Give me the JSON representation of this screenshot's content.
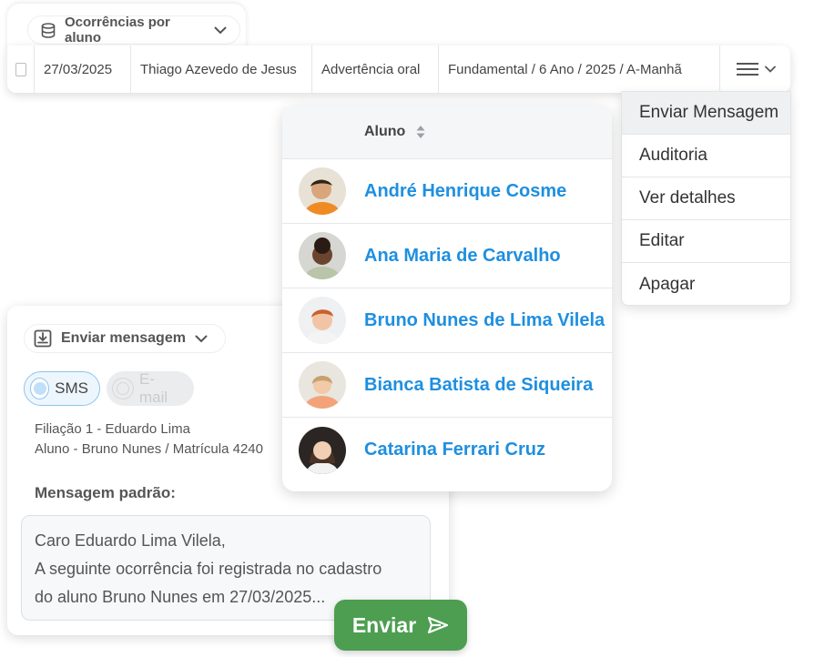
{
  "top_tab": {
    "label": "Ocorrências por aluno"
  },
  "occurrence_row": {
    "date": "27/03/2025",
    "student": "Thiago Azevedo de Jesus",
    "type": "Advertência oral",
    "class": "Fundamental / 6 Ano / 2025 / A-Manhã"
  },
  "row_menu": {
    "items": [
      "Enviar Mensagem",
      "Auditoria",
      "Ver detalhes",
      "Editar",
      "Apagar"
    ]
  },
  "students_table": {
    "header": "Aluno",
    "rows": [
      {
        "name": "André Henrique Cosme"
      },
      {
        "name": "Ana Maria de Carvalho"
      },
      {
        "name": "Bruno Nunes de Lima Vilela"
      },
      {
        "name": "Bianca Batista de Siqueira"
      },
      {
        "name": "Catarina Ferrari Cruz"
      }
    ]
  },
  "send_message": {
    "title": "Enviar mensagem",
    "channels": {
      "sms": "SMS",
      "email": "E-mail"
    },
    "filiation": "Filiação 1 - Eduardo Lima",
    "student_info": "Aluno - Bruno Nunes / Matrícula 4240",
    "default_label": "Mensagem padrão:",
    "message_lines": [
      "Caro Eduardo Lima Vilela,",
      "A seguinte ocorrência foi registrada no cadastro",
      "do aluno Bruno Nunes em 27/03/2025..."
    ],
    "send_label": "Enviar"
  },
  "colors": {
    "link_blue": "#1e8fe0",
    "send_green": "#4d9e50",
    "menu_highlight": "#eef0f2"
  }
}
